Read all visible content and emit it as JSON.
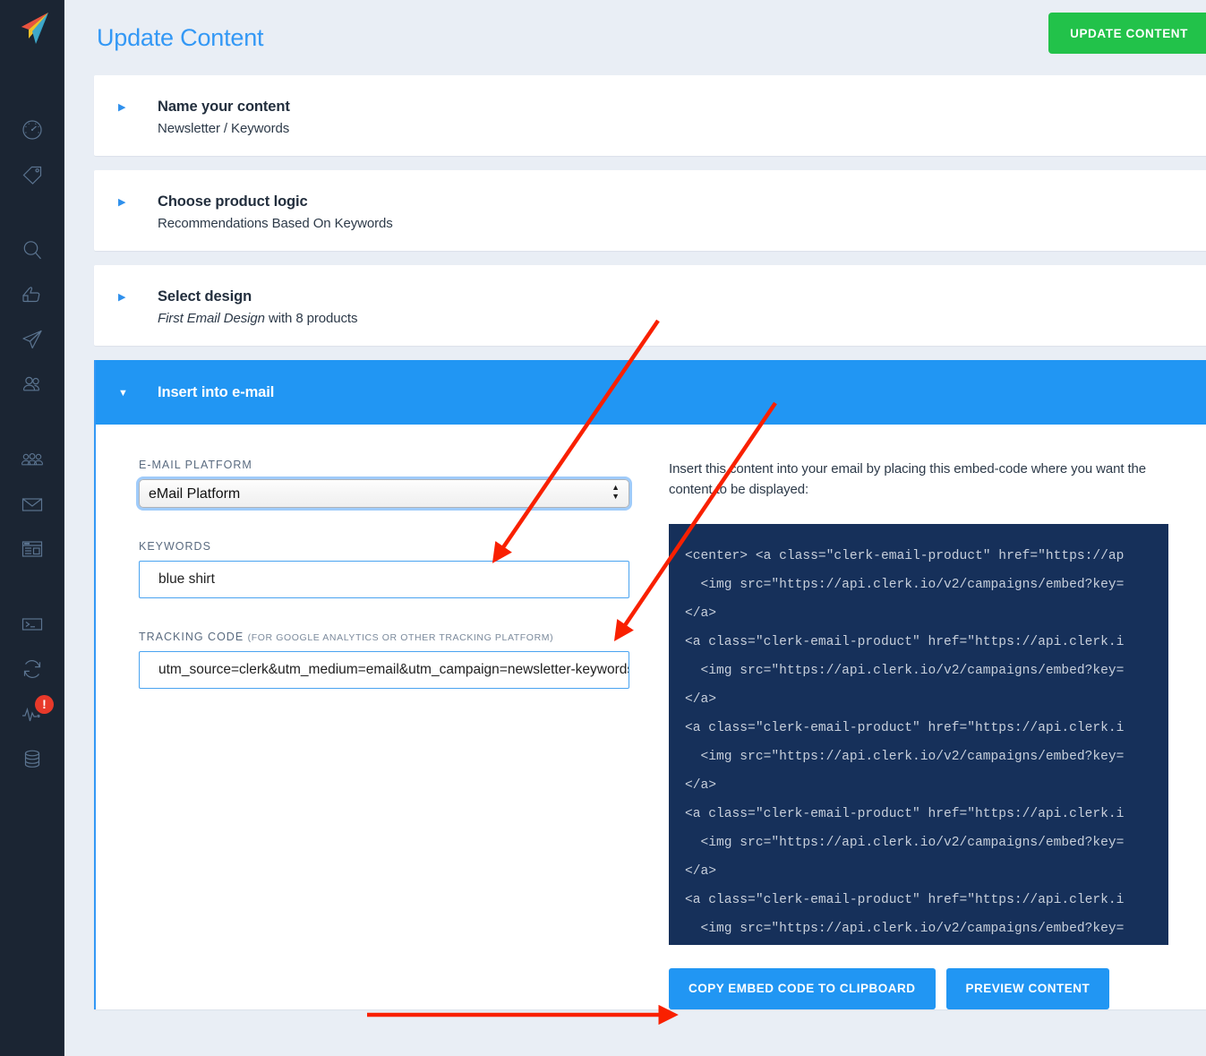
{
  "brand": {
    "logo_icon": "paper-plane-logo",
    "accent_blue": "#2196f3",
    "title_blue": "#3398f5",
    "green": "#22c24a",
    "sidebar_bg": "#1b2533",
    "page_bg": "#e9eef5",
    "code_bg": "#16305a",
    "annotation_red": "#f92000"
  },
  "sidebar": {
    "items": [
      {
        "icon": "dashboard-gauge-icon",
        "name": "sidebar-item-dashboard"
      },
      {
        "icon": "tag-icon",
        "name": "sidebar-item-tags"
      },
      {
        "icon": "search-magnifier-icon",
        "name": "sidebar-item-search"
      },
      {
        "icon": "thumbs-up-icon",
        "name": "sidebar-item-recommendations"
      },
      {
        "icon": "paper-plane-icon",
        "name": "sidebar-item-email"
      },
      {
        "icon": "two-users-icon",
        "name": "sidebar-item-audience"
      },
      {
        "icon": "three-users-icon",
        "name": "sidebar-item-segments"
      },
      {
        "icon": "envelope-icon",
        "name": "sidebar-item-mail"
      },
      {
        "icon": "browser-window-icon",
        "name": "sidebar-item-web"
      },
      {
        "icon": "terminal-icon",
        "name": "sidebar-item-console"
      },
      {
        "icon": "sync-refresh-icon",
        "name": "sidebar-item-sync"
      },
      {
        "icon": "pulse-activity-icon",
        "name": "sidebar-item-activity",
        "badge": "!"
      },
      {
        "icon": "database-icon",
        "name": "sidebar-item-data"
      }
    ]
  },
  "header": {
    "title": "Update Content",
    "update_button": "UPDATE CONTENT"
  },
  "cards": [
    {
      "title": "Name your content",
      "subtitle": "Newsletter / Keywords",
      "expanded": false,
      "caret": "right"
    },
    {
      "title": "Choose product logic",
      "subtitle": "Recommendations Based On Keywords",
      "expanded": false,
      "caret": "right"
    },
    {
      "title": "Select design",
      "subtitle_em": "First Email Design",
      "subtitle_rest": " with 8 products",
      "expanded": false,
      "caret": "right"
    }
  ],
  "panel": {
    "title": "Insert into e-mail",
    "caret": "down",
    "expanded": true,
    "fields": {
      "platform_label": "E-MAIL PLATFORM",
      "platform_value": "eMail Platform",
      "platform_options": [
        "eMail Platform"
      ],
      "keywords_label": "KEYWORDS",
      "keywords_value": "blue shirt",
      "tracking_label": "TRACKING CODE",
      "tracking_hint": "(FOR GOOGLE ANALYTICS OR OTHER TRACKING PLATFORM)",
      "tracking_value": "utm_source=clerk&utm_medium=email&utm_campaign=newsletter-keywords"
    },
    "embed_note": "Insert this content into your email by placing this embed-code where you want the content to be displayed:",
    "embed_code_lines": [
      "<center> <a class=\"clerk-email-product\" href=\"https://ap",
      "  <img src=\"https://api.clerk.io/v2/campaigns/embed?key=",
      "</a>",
      "<a class=\"clerk-email-product\" href=\"https://api.clerk.i",
      "  <img src=\"https://api.clerk.io/v2/campaigns/embed?key=",
      "</a>",
      "<a class=\"clerk-email-product\" href=\"https://api.clerk.i",
      "  <img src=\"https://api.clerk.io/v2/campaigns/embed?key=",
      "</a>",
      "<a class=\"clerk-email-product\" href=\"https://api.clerk.i",
      "  <img src=\"https://api.clerk.io/v2/campaigns/embed?key=",
      "</a>",
      "<a class=\"clerk-email-product\" href=\"https://api.clerk.i",
      "  <img src=\"https://api.clerk.io/v2/campaigns/embed?key="
    ],
    "copy_button": "COPY EMBED CODE TO CLIPBOARD",
    "preview_button": "PREVIEW CONTENT"
  },
  "annotations": {
    "arrow_1": "points-to-email-platform-select",
    "arrow_2": "points-to-keywords-input",
    "arrow_3": "points-to-copy-embed-code-button"
  }
}
